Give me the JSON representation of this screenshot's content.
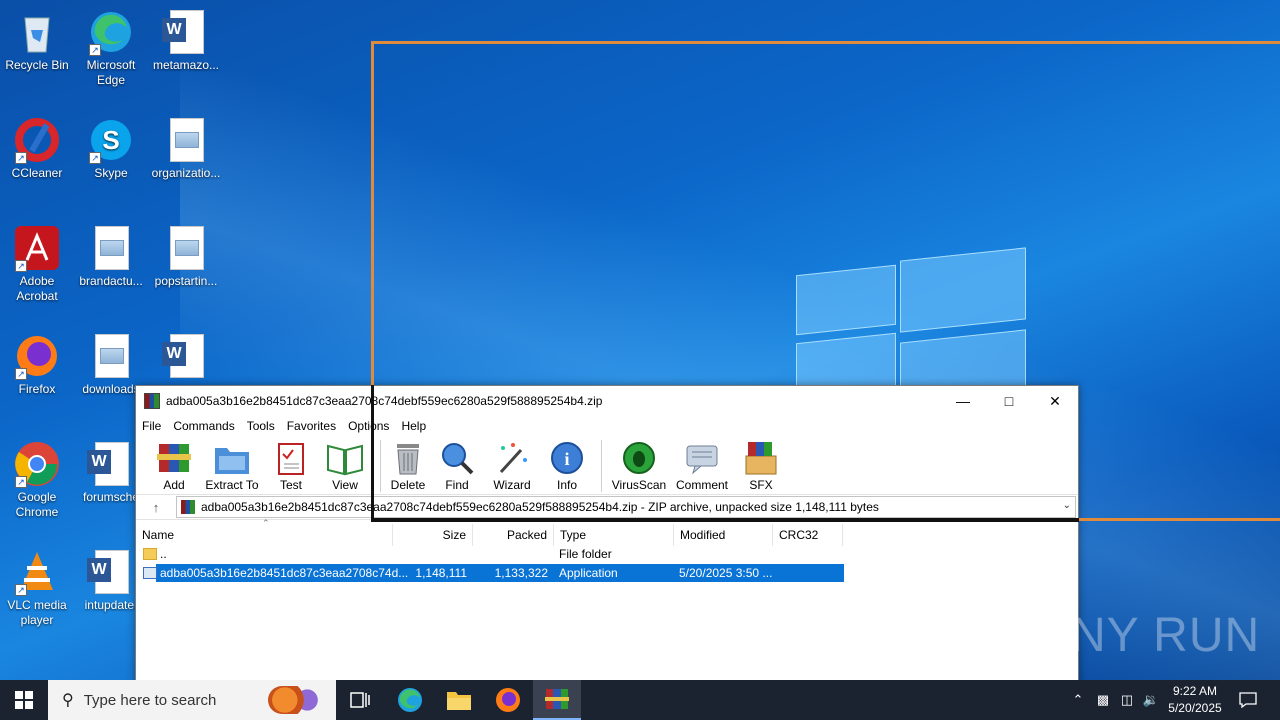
{
  "desktop": {
    "icons": [
      {
        "label": "Recycle Bin",
        "icon": "recycle-bin-icon"
      },
      {
        "label": "Microsoft Edge",
        "icon": "edge-icon"
      },
      {
        "label": "metamazo...",
        "icon": "word-doc-icon"
      },
      {
        "label": "CCleaner",
        "icon": "ccleaner-icon"
      },
      {
        "label": "Skype",
        "icon": "skype-icon"
      },
      {
        "label": "organizatio...",
        "icon": "image-file-icon"
      },
      {
        "label": "Adobe Acrobat",
        "icon": "acrobat-icon"
      },
      {
        "label": "brandactu...",
        "icon": "image-file-icon"
      },
      {
        "label": "popstartin...",
        "icon": "image-file-icon"
      },
      {
        "label": "Firefox",
        "icon": "firefox-icon"
      },
      {
        "label": "downloads",
        "icon": "image-file-icon"
      },
      {
        "label": "",
        "icon": "word-doc-icon"
      },
      {
        "label": "Google Chrome",
        "icon": "chrome-icon"
      },
      {
        "label": "forumsche",
        "icon": "word-doc-icon"
      },
      {
        "label": "VLC media player",
        "icon": "vlc-icon"
      },
      {
        "label": "intupdate.",
        "icon": "word-doc-icon"
      }
    ]
  },
  "window": {
    "title": "adba005a3b16e2b8451dc87c3eaa2708c74debf559ec6280a529f588895254b4.zip",
    "menu": [
      "File",
      "Commands",
      "Tools",
      "Favorites",
      "Options",
      "Help"
    ],
    "toolbar": [
      "Add",
      "Extract To",
      "Test",
      "View",
      "Delete",
      "Find",
      "Wizard",
      "Info",
      "VirusScan",
      "Comment",
      "SFX"
    ],
    "address": "adba005a3b16e2b8451dc87c3eaa2708c74debf559ec6280a529f588895254b4.zip - ZIP archive, unpacked size 1,148,111 bytes",
    "columns": [
      "Name",
      "Size",
      "Packed",
      "Type",
      "Modified",
      "CRC32"
    ],
    "rows": [
      {
        "name": "..",
        "size": "",
        "packed": "",
        "type": "File folder",
        "modified": ""
      },
      {
        "name": "adba005a3b16e2b8451dc87c3eaa2708c74d...",
        "size": "1,148,111",
        "packed": "1,133,322",
        "type": "Application",
        "modified": "5/20/2025 3:50 ..."
      }
    ]
  },
  "taskbar": {
    "search_placeholder": "Type here to search",
    "time": "9:22 AM",
    "date": "5/20/2025"
  },
  "watermark": "ANY RUN"
}
